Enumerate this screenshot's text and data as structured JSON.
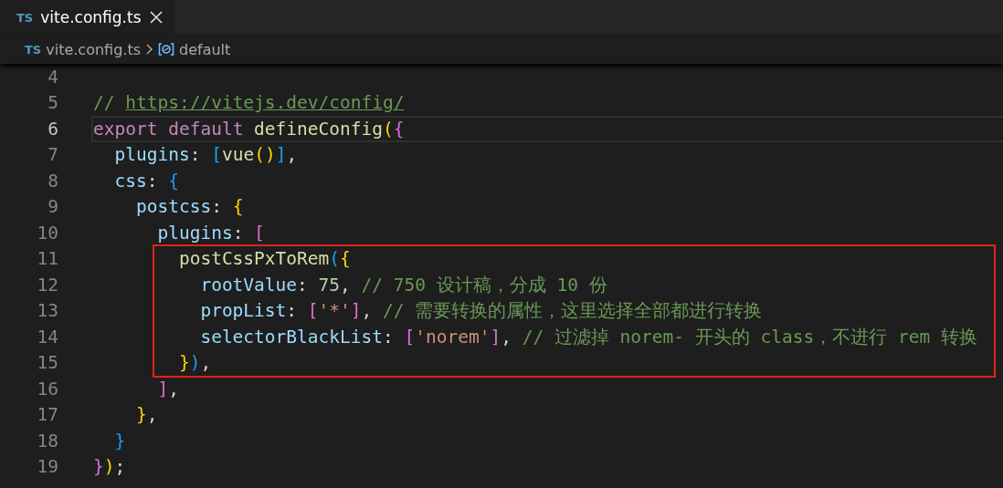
{
  "tab": {
    "icon_text": "TS",
    "title": "vite.config.ts",
    "selected": true
  },
  "breadcrumb": [
    {
      "kind": "file",
      "icon_text": "TS",
      "label": "vite.config.ts"
    },
    {
      "kind": "symbol",
      "label": "default"
    }
  ],
  "lines": [
    {
      "number": "4",
      "current": false,
      "boxed": false
    },
    {
      "number": "5",
      "current": false,
      "boxed": false,
      "tokens": [
        {
          "text": "// ",
          "kind": "comment"
        },
        {
          "text": "https://vitejs.dev/config/",
          "kind": "link"
        }
      ]
    },
    {
      "number": "6",
      "current": true,
      "boxed": false,
      "tokens": [
        {
          "text": "export ",
          "kind": "keyword"
        },
        {
          "text": "default ",
          "kind": "keyword"
        },
        {
          "text": "defineConfig",
          "kind": "function"
        },
        {
          "text": "(",
          "kind": "bracket1"
        },
        {
          "text": "{",
          "kind": "bracket2"
        }
      ]
    },
    {
      "number": "7",
      "current": false,
      "boxed": false,
      "tokens": [
        {
          "text": "  plugins",
          "kind": "property"
        },
        {
          "text": ": ",
          "kind": "punct"
        },
        {
          "text": "[",
          "kind": "bracket3"
        },
        {
          "text": "vue",
          "kind": "function"
        },
        {
          "text": "()",
          "kind": "bracket1"
        },
        {
          "text": "]",
          "kind": "bracket3"
        },
        {
          "text": ",",
          "kind": "punct"
        }
      ]
    },
    {
      "number": "8",
      "current": false,
      "boxed": false,
      "tokens": [
        {
          "text": "  css",
          "kind": "property"
        },
        {
          "text": ": ",
          "kind": "punct"
        },
        {
          "text": "{",
          "kind": "bracket3"
        }
      ]
    },
    {
      "number": "9",
      "current": false,
      "boxed": false,
      "tokens": [
        {
          "text": "    postcss",
          "kind": "property"
        },
        {
          "text": ": ",
          "kind": "punct"
        },
        {
          "text": "{",
          "kind": "bracket1"
        }
      ]
    },
    {
      "number": "10",
      "current": false,
      "boxed": false,
      "tokens": [
        {
          "text": "      plugins",
          "kind": "property"
        },
        {
          "text": ": ",
          "kind": "punct"
        },
        {
          "text": "[",
          "kind": "bracket2"
        }
      ]
    },
    {
      "number": "11",
      "current": false,
      "boxed": true,
      "tokens": [
        {
          "text": "        postCssPxToRem",
          "kind": "function"
        },
        {
          "text": "(",
          "kind": "bracket3"
        },
        {
          "text": "{",
          "kind": "bracket1"
        }
      ]
    },
    {
      "number": "12",
      "current": false,
      "boxed": true,
      "tokens": [
        {
          "text": "          rootValue",
          "kind": "property"
        },
        {
          "text": ": ",
          "kind": "punct"
        },
        {
          "text": "75",
          "kind": "number"
        },
        {
          "text": ", ",
          "kind": "punct"
        },
        {
          "text": "// 750 设计稿，分成 10 份",
          "kind": "comment"
        }
      ]
    },
    {
      "number": "13",
      "current": false,
      "boxed": true,
      "tokens": [
        {
          "text": "          propList",
          "kind": "property"
        },
        {
          "text": ": ",
          "kind": "punct"
        },
        {
          "text": "[",
          "kind": "bracket2"
        },
        {
          "text": "'*'",
          "kind": "string"
        },
        {
          "text": "]",
          "kind": "bracket2"
        },
        {
          "text": ", ",
          "kind": "punct"
        },
        {
          "text": "// 需要转换的属性，这里选择全部都进行转换",
          "kind": "comment"
        }
      ]
    },
    {
      "number": "14",
      "current": false,
      "boxed": true,
      "tokens": [
        {
          "text": "          selectorBlackList",
          "kind": "property"
        },
        {
          "text": ": ",
          "kind": "punct"
        },
        {
          "text": "[",
          "kind": "bracket2"
        },
        {
          "text": "'norem'",
          "kind": "string"
        },
        {
          "text": "]",
          "kind": "bracket2"
        },
        {
          "text": ", ",
          "kind": "punct"
        },
        {
          "text": "// 过滤掉 norem- 开头的 class，不进行 rem 转换",
          "kind": "comment"
        }
      ]
    },
    {
      "number": "15",
      "current": false,
      "boxed": true,
      "tokens": [
        {
          "text": "        }",
          "kind": "bracket1"
        },
        {
          "text": ")",
          "kind": "bracket3"
        },
        {
          "text": ",",
          "kind": "punct"
        }
      ]
    },
    {
      "number": "16",
      "current": false,
      "boxed": false,
      "tokens": [
        {
          "text": "      ]",
          "kind": "bracket2"
        },
        {
          "text": ",",
          "kind": "punct"
        }
      ]
    },
    {
      "number": "17",
      "current": false,
      "boxed": false,
      "tokens": [
        {
          "text": "    }",
          "kind": "bracket1"
        },
        {
          "text": ",",
          "kind": "punct"
        }
      ]
    },
    {
      "number": "18",
      "current": false,
      "boxed": false,
      "tokens": [
        {
          "text": "  }",
          "kind": "bracket3"
        }
      ]
    },
    {
      "number": "19",
      "current": false,
      "boxed": false,
      "tokens": [
        {
          "text": "}",
          "kind": "bracket2"
        },
        {
          "text": ")",
          "kind": "bracket1"
        },
        {
          "text": ";",
          "kind": "punct"
        }
      ]
    }
  ]
}
